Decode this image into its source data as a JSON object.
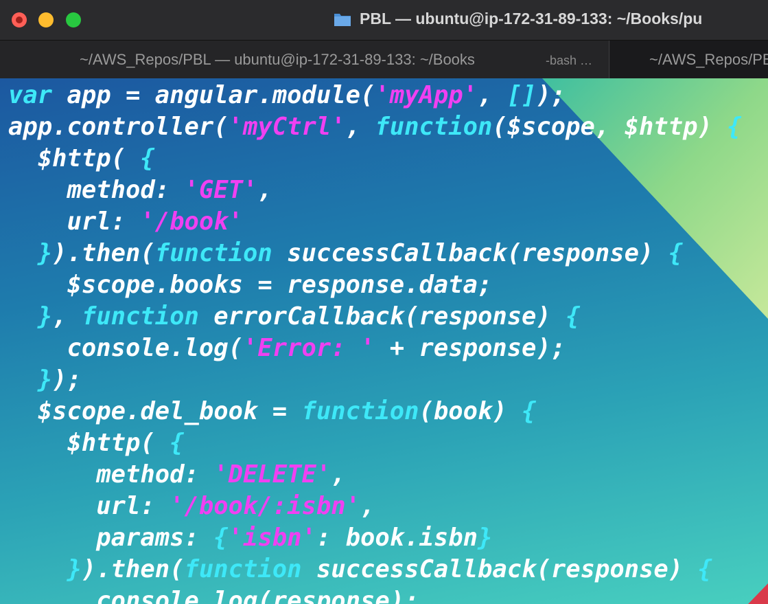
{
  "window": {
    "title": "PBL — ubuntu@ip-172-31-89-133: ~/Books/pu",
    "folder_icon": "folder-icon"
  },
  "tabs": [
    {
      "label": "~/AWS_Repos/PBL — ubuntu@ip-172-31-89-133: ~/Books",
      "process": "-bash …",
      "active": true
    },
    {
      "label": "~/AWS_Repos/PBL",
      "active": false
    }
  ],
  "colors": {
    "keyword": "#3ee8f8",
    "string": "#f040f2",
    "text": "#ffffff",
    "close": "#ff5f57",
    "minimize": "#febc2e",
    "zoom": "#28c840"
  },
  "code": [
    [
      [
        "kw",
        "var"
      ],
      [
        "t",
        " app = angular.module("
      ],
      [
        "str",
        "'myApp'"
      ],
      [
        "t",
        ", "
      ],
      [
        "br",
        "[]"
      ],
      [
        "t",
        ");"
      ]
    ],
    [
      [
        "t",
        "app.controller("
      ],
      [
        "str",
        "'myCtrl'"
      ],
      [
        "t",
        ", "
      ],
      [
        "kw",
        "function"
      ],
      [
        "t",
        "($scope, $http) "
      ],
      [
        "br",
        "{"
      ]
    ],
    [
      [
        "t",
        "  $http( "
      ],
      [
        "br",
        "{"
      ]
    ],
    [
      [
        "t",
        "    method: "
      ],
      [
        "str",
        "'GET'"
      ],
      [
        "t",
        ","
      ]
    ],
    [
      [
        "t",
        "    url: "
      ],
      [
        "str",
        "'/book'"
      ]
    ],
    [
      [
        "t",
        "  "
      ],
      [
        "br",
        "}"
      ],
      [
        "t",
        ").then("
      ],
      [
        "kw",
        "function"
      ],
      [
        "t",
        " successCallback(response) "
      ],
      [
        "br",
        "{"
      ]
    ],
    [
      [
        "t",
        "    $scope.books = response.data;"
      ]
    ],
    [
      [
        "t",
        "  "
      ],
      [
        "br",
        "}"
      ],
      [
        "t",
        ", "
      ],
      [
        "kw",
        "function"
      ],
      [
        "t",
        " errorCallback(response) "
      ],
      [
        "br",
        "{"
      ]
    ],
    [
      [
        "t",
        "    console.log("
      ],
      [
        "str",
        "'Error: '"
      ],
      [
        "t",
        " + response);"
      ]
    ],
    [
      [
        "t",
        "  "
      ],
      [
        "br",
        "}"
      ],
      [
        "t",
        ");"
      ]
    ],
    [
      [
        "t",
        "  $scope.del_book = "
      ],
      [
        "kw",
        "function"
      ],
      [
        "t",
        "(book) "
      ],
      [
        "br",
        "{"
      ]
    ],
    [
      [
        "t",
        "    $http( "
      ],
      [
        "br",
        "{"
      ]
    ],
    [
      [
        "t",
        "      method: "
      ],
      [
        "str",
        "'DELETE'"
      ],
      [
        "t",
        ","
      ]
    ],
    [
      [
        "t",
        "      url: "
      ],
      [
        "str",
        "'/book/:isbn'"
      ],
      [
        "t",
        ","
      ]
    ],
    [
      [
        "t",
        "      params: "
      ],
      [
        "br",
        "{"
      ],
      [
        "str",
        "'isbn'"
      ],
      [
        "t",
        ": book.isbn"
      ],
      [
        "br",
        "}"
      ]
    ],
    [
      [
        "t",
        "    "
      ],
      [
        "br",
        "}"
      ],
      [
        "t",
        ").then("
      ],
      [
        "kw",
        "function"
      ],
      [
        "t",
        " successCallback(response) "
      ],
      [
        "br",
        "{"
      ]
    ],
    [
      [
        "t",
        "      console.log(response);"
      ]
    ]
  ]
}
